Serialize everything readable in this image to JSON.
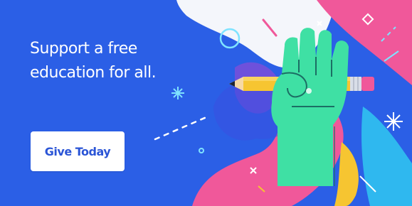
{
  "banner": {
    "headline_line1": "Support a free",
    "headline_line2": "education for all.",
    "cta_label": "Give Today"
  },
  "icons": [
    "pencil-icon",
    "raised-fist-icon",
    "sparkle-icon",
    "circle-icon",
    "diamond-icon",
    "x-mark-icon"
  ],
  "colors": {
    "background": "#2b5fe6",
    "accent_pink": "#f0589a",
    "accent_green": "#3fe0a4",
    "accent_light_blue": "#2fb8ef",
    "accent_yellow": "#f6c531",
    "button_text": "#2b55d6",
    "text_white": "#ffffff"
  }
}
